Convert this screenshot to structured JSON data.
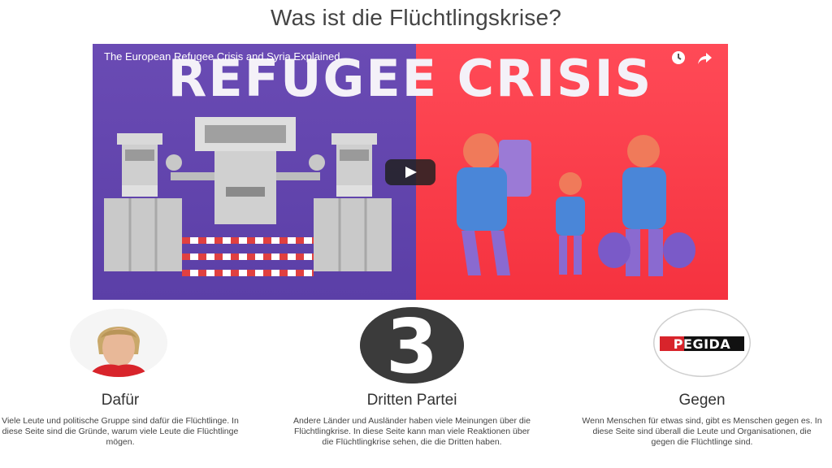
{
  "page": {
    "title": "Was ist die Flüchtlingskrise?"
  },
  "video": {
    "title": "The European Refugee Crisis and Syria Explained",
    "banner_text": "REFUGEE CRISIS",
    "controls": {
      "watch_later_icon": "clock-icon",
      "share_icon": "share-arrow-icon",
      "play_icon": "play-icon"
    },
    "colors": {
      "left_bg": "#5b3fa7",
      "right_bg": "#f5323f"
    }
  },
  "columns": [
    {
      "heading": "Dafür",
      "text": "Viele Leute und politische Gruppe sind dafür die Flüchtlinge. In diese Seite sind die Gründe, warum viele Leute die Flüchtlinge mögen."
    },
    {
      "heading": "Dritten Partei",
      "badge": "3",
      "text": "Andere Länder und Ausländer haben viele Meinungen über die Flüchtlingkrise. In diese Seite kann man viele Reaktionen über die Flüchtlingkrise sehen, die die Dritten haben."
    },
    {
      "heading": "Gegen",
      "logo_text": "PEGIDA",
      "text": "Wenn Menschen für etwas sind, gibt es Menschen gegen es. In diese Seite sind überall die Leute und Organisationen, die gegen die Flüchtlinge sind."
    }
  ]
}
